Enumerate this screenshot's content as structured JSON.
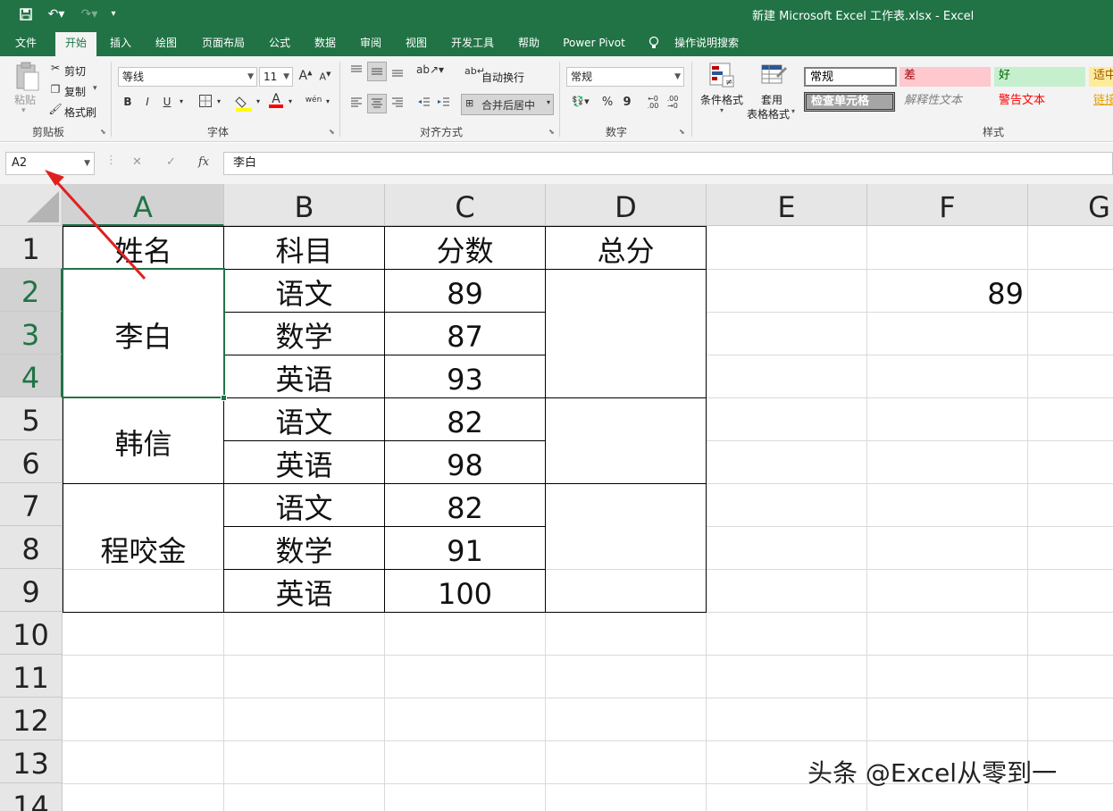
{
  "window": {
    "title": "新建 Microsoft Excel 工作表.xlsx  -  Excel"
  },
  "tabs": [
    "文件",
    "开始",
    "插入",
    "绘图",
    "页面布局",
    "公式",
    "数据",
    "审阅",
    "视图",
    "开发工具",
    "帮助",
    "Power Pivot",
    "操作说明搜索"
  ],
  "ribbon": {
    "clipboard": {
      "paste": "粘贴",
      "cut": "剪切",
      "copy": "复制",
      "format_painter": "格式刷",
      "label": "剪贴板"
    },
    "font": {
      "name": "等线",
      "size": "11",
      "grow": "A",
      "shrink": "A",
      "bold": "B",
      "italic": "I",
      "underline": "U",
      "font_color": "A",
      "phonetic": "wén",
      "label": "字体"
    },
    "alignment": {
      "wrap": "自动换行",
      "merge": "合并后居中",
      "label": "对齐方式"
    },
    "number": {
      "format": "常规",
      "percent": "%",
      "comma": "9",
      "label": "数字"
    },
    "styles": {
      "conditional": "条件格式",
      "table1": "套用",
      "table2": "表格格式",
      "normal": "常规",
      "bad": "差",
      "good": "好",
      "neutral": "适中",
      "check": "检查单元格",
      "explanatory": "解释性文本",
      "warning": "警告文本",
      "link": "链接",
      "label": "样式"
    }
  },
  "formula_bar": {
    "name_box": "A2",
    "cancel": "✕",
    "enter": "✓",
    "fx": "fx",
    "content": "李白"
  },
  "sheet": {
    "columns": [
      "A",
      "B",
      "C",
      "D",
      "E",
      "F",
      "G"
    ],
    "rows": [
      "1",
      "2",
      "3",
      "4",
      "5",
      "6",
      "7",
      "8",
      "9",
      "10",
      "11",
      "12",
      "13",
      "14"
    ],
    "header": {
      "name": "姓名",
      "subject": "科目",
      "score": "分数",
      "total": "总分"
    },
    "people": [
      "李白",
      "韩信",
      "程咬金"
    ],
    "subjects": [
      "语文",
      "数学",
      "英语",
      "语文",
      "英语",
      "语文",
      "数学",
      "英语"
    ],
    "scores": [
      "89",
      "87",
      "93",
      "82",
      "98",
      "82",
      "91",
      "100"
    ],
    "f2": "89"
  },
  "watermark": "头条 @Excel从零到一",
  "colors": {
    "accent": "#217346",
    "arrow": "#e02020"
  }
}
